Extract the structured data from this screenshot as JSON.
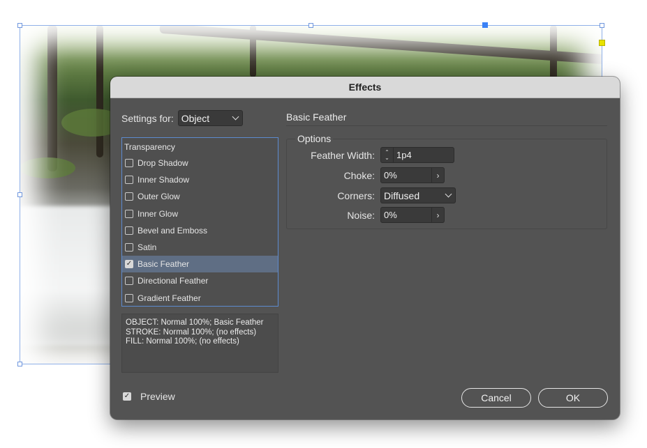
{
  "dialog": {
    "title": "Effects",
    "settings_for_label": "Settings for:",
    "settings_for_value": "Object",
    "list_heading": "Transparency",
    "effects": [
      {
        "label": "Drop Shadow",
        "checked": false,
        "selected": false
      },
      {
        "label": "Inner Shadow",
        "checked": false,
        "selected": false
      },
      {
        "label": "Outer Glow",
        "checked": false,
        "selected": false
      },
      {
        "label": "Inner Glow",
        "checked": false,
        "selected": false
      },
      {
        "label": "Bevel and Emboss",
        "checked": false,
        "selected": false
      },
      {
        "label": "Satin",
        "checked": false,
        "selected": false
      },
      {
        "label": "Basic Feather",
        "checked": true,
        "selected": true
      },
      {
        "label": "Directional Feather",
        "checked": false,
        "selected": false
      },
      {
        "label": "Gradient Feather",
        "checked": false,
        "selected": false
      }
    ],
    "summary": [
      "OBJECT: Normal 100%; Basic Feather",
      "STROKE: Normal 100%; (no effects)",
      "FILL: Normal 100%; (no effects)"
    ],
    "preview_label": "Preview",
    "preview_checked": true,
    "section_title": "Basic Feather",
    "options_legend": "Options",
    "options": {
      "feather_width_label": "Feather Width:",
      "feather_width_value": "1p4",
      "choke_label": "Choke:",
      "choke_value": "0%",
      "corners_label": "Corners:",
      "corners_value": "Diffused",
      "noise_label": "Noise:",
      "noise_value": "0%"
    },
    "cancel_label": "Cancel",
    "ok_label": "OK"
  }
}
